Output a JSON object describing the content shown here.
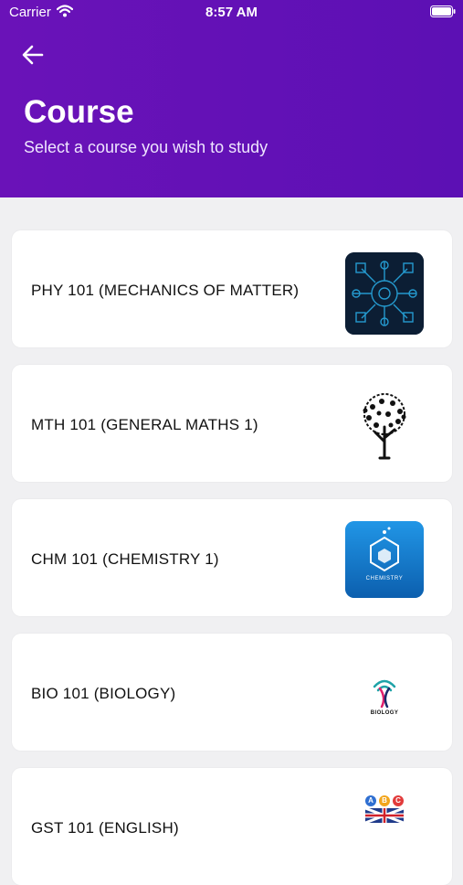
{
  "status_bar": {
    "carrier": "Carrier",
    "time": "8:57 AM"
  },
  "header": {
    "title": "Course",
    "subtitle": "Select a course you wish to study"
  },
  "courses": [
    {
      "label": "PHY 101 (MECHANICS OF MATTER)",
      "thumbnail_icon": "physics-circuit-icon"
    },
    {
      "label": "MTH 101 (GENERAL MATHS 1)",
      "thumbnail_icon": "math-tree-icon"
    },
    {
      "label": "CHM 101 (CHEMISTRY 1)",
      "thumbnail_icon": "chemistry-flask-icon",
      "thumbnail_text": "CHEMISTRY"
    },
    {
      "label": "BIO 101 (BIOLOGY)",
      "thumbnail_icon": "biology-dna-icon",
      "thumbnail_text": "BIOLOGY"
    },
    {
      "label": "GST 101 (ENGLISH)",
      "thumbnail_icon": "english-abc-icon",
      "thumbnail_letters": [
        "A",
        "B",
        "C"
      ]
    }
  ],
  "colors": {
    "header_purple": "#6a12b8",
    "background": "#f0f0f2"
  }
}
